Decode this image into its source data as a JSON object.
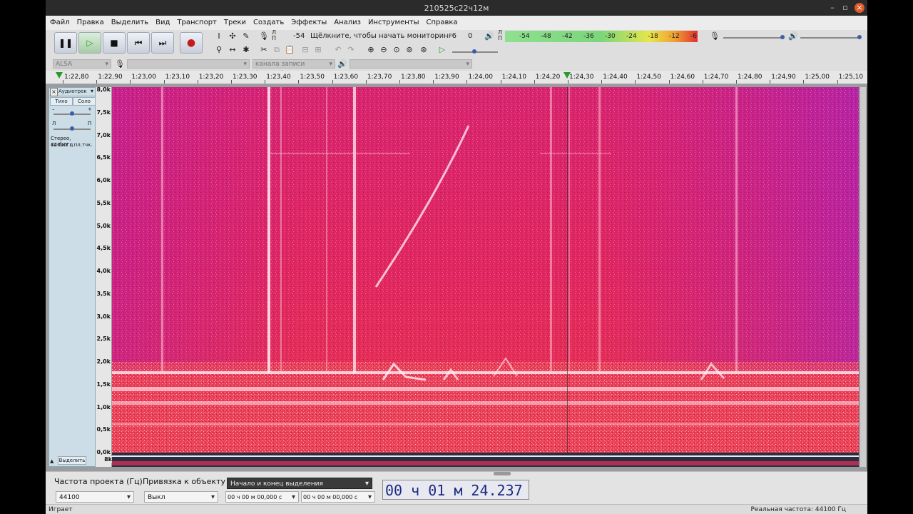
{
  "window": {
    "title": "210525с22ч12м"
  },
  "menu": [
    "Файл",
    "Правка",
    "Выделить",
    "Вид",
    "Транспорт",
    "Треки",
    "Создать",
    "Эффекты",
    "Анализ",
    "Инструменты",
    "Справка"
  ],
  "toolbar": {
    "record_meter_text": "Щёлкните, чтобы начать мониторинг",
    "record_meter_levels": [
      "-54",
      "-6",
      "0"
    ],
    "meter_lr": [
      "Л",
      "П"
    ],
    "playback_meter_scale": [
      "-54",
      "-48",
      "-42",
      "-36",
      "-30",
      "-24",
      "-18",
      "-12",
      "-6"
    ],
    "host": "ALSA",
    "channels": "канала записи (стерео)"
  },
  "ruler": {
    "labels": [
      "1:22,80",
      "1:22,90",
      "1:23,00",
      "1:23,10",
      "1:23,20",
      "1:23,30",
      "1:23,40",
      "1:23,50",
      "1:23,60",
      "1:23,70",
      "1:23,80",
      "1:23,90",
      "1:24,00",
      "1:24,10",
      "1:24,20",
      "1:24,30",
      "1:24,40",
      "1:24,50",
      "1:24,60",
      "1:24,70",
      "1:24,80",
      "1:24,90",
      "1:25,00",
      "1:25,10"
    ]
  },
  "track": {
    "name": "Аудиотрек",
    "mute": "Тихо",
    "solo": "Соло",
    "gain_minus": "–",
    "gain_plus": "+",
    "pan_left": "Л",
    "pan_right": "П",
    "info_line1": "Стерео, 44100Гц",
    "info_line2": "32-бит с пл.тчк.",
    "select_button": "Выделить",
    "freq_labels": [
      "8,0k",
      "7,5k",
      "7,0k",
      "6,5k",
      "6,0k",
      "5,5k",
      "5,0k",
      "4,5k",
      "4,0k",
      "3,5k",
      "3,0k",
      "2,5k",
      "2,0k",
      "1,5k",
      "1,0k",
      "0,5k",
      "0,0k"
    ],
    "bottom_label": "8k"
  },
  "selection": {
    "rate_label": "Частота проекта (Гц)",
    "rate_value": "44100",
    "snap_label": "Привязка к объекту",
    "snap_value": "Выкл",
    "mode": "Начало и конец выделения",
    "start": "00 ч 00 м 00,000 с",
    "end": "00 ч 00 м 00,000 с",
    "position": "00 ч 01 м 24.237 с"
  },
  "status": {
    "left": "Играет",
    "right": "Реальная частота: 44100 Гц"
  }
}
